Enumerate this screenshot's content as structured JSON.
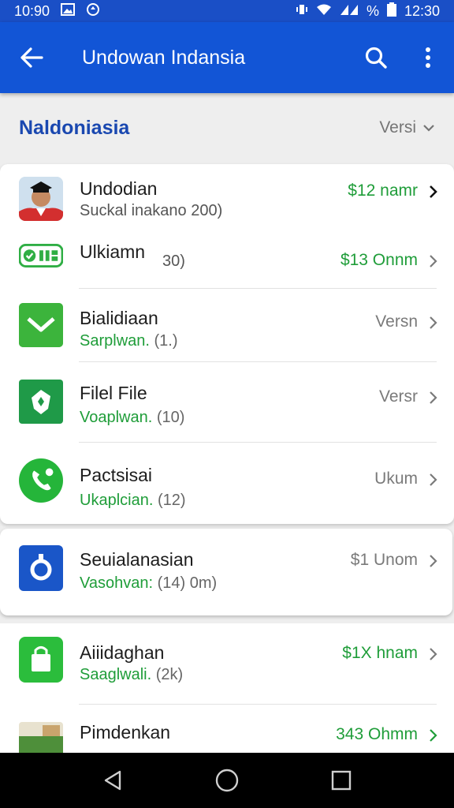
{
  "status_bar": {
    "time_left": "10:90",
    "time_right": "12:30",
    "battery_label": "%"
  },
  "app_bar": {
    "title": "Undowan Indansia"
  },
  "section": {
    "title": "Naldoniasia",
    "sort_label": "Versi"
  },
  "apps": [
    {
      "name": "Undodian",
      "subtitle": "Suckal inakano 200)",
      "price": "$12 namr"
    },
    {
      "name": "Ulkiamn",
      "subtitle": "30)",
      "price": "$13 Onnm"
    },
    {
      "name": "Bialidiaan",
      "subtitle": "Sarplwan.",
      "count": "(1.)",
      "price": "Versn"
    },
    {
      "name": "Filel File",
      "subtitle": "Voaplwan.",
      "count": "(10)",
      "price": "Versr"
    },
    {
      "name": "Pactsisai",
      "subtitle": "Ukaplcian.",
      "count": "(12)",
      "price": "Ukum"
    },
    {
      "name": "Seuialanasian",
      "subtitle": "Vasohvan:",
      "count": "(14) 0m)",
      "price": "$1 Unom"
    },
    {
      "name": "Aiiidaghan",
      "subtitle": "Saaglwali.",
      "count": "(2k)",
      "price": "$1X hnam"
    },
    {
      "name": "Pimdenkan",
      "subtitle": "",
      "count": "",
      "price": "343 Ohmm"
    }
  ],
  "colors": {
    "app_bar": "#1255d6",
    "status_bar": "#1a4fc6",
    "accent_blue": "#1a48b0",
    "price_green": "#1f9d39"
  }
}
